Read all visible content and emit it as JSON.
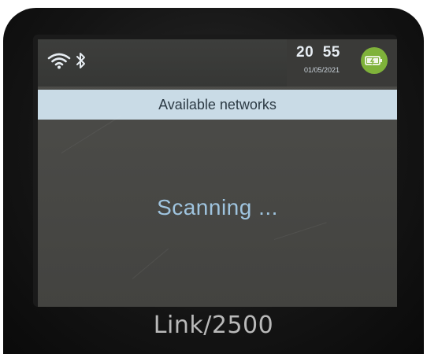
{
  "status_bar": {
    "wifi_icon": "wifi-icon",
    "bluetooth_icon": "bluetooth-icon",
    "time_hour": "20",
    "time_minute": "55",
    "date": "01/05/2021",
    "battery_icon": "battery-charging-icon",
    "battery_color": "#7fb23a"
  },
  "header": {
    "title": "Available networks"
  },
  "main": {
    "status_message": "Scanning ..."
  },
  "device": {
    "model_label": "Link/2500"
  },
  "colors": {
    "title_bar": "#c9dbe6",
    "screen_bg": "#4a4a47",
    "status_text": "#9fc4df"
  }
}
